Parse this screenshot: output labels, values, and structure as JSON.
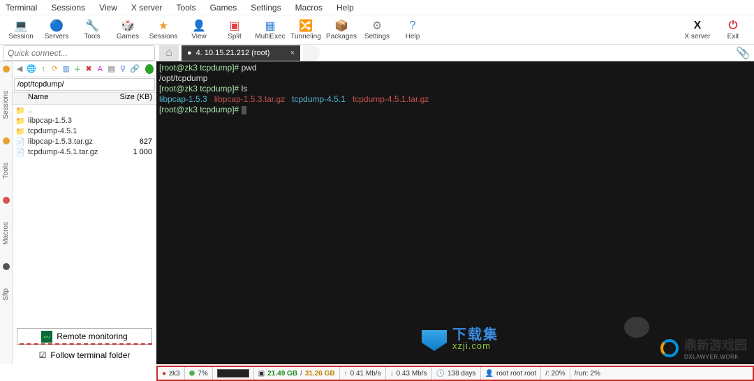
{
  "menu": [
    "Terminal",
    "Sessions",
    "View",
    "X server",
    "Tools",
    "Games",
    "Settings",
    "Macros",
    "Help"
  ],
  "toolbar": [
    {
      "name": "session-btn",
      "label": "Session",
      "icon": "💻",
      "color": "#3a84d8"
    },
    {
      "name": "servers-btn",
      "label": "Servers",
      "icon": "🔵",
      "color": "#e07030"
    },
    {
      "name": "tools-btn",
      "label": "Tools",
      "icon": "🔧",
      "color": "#555"
    },
    {
      "name": "games-btn",
      "label": "Games",
      "icon": "🎲",
      "color": "#d44"
    },
    {
      "name": "sessions-btn",
      "label": "Sessions",
      "icon": "★",
      "color": "#e8a030"
    },
    {
      "name": "view-btn",
      "label": "View",
      "icon": "👤",
      "color": "#33a852"
    },
    {
      "name": "split-btn",
      "label": "Split",
      "icon": "▣",
      "color": "#d44"
    },
    {
      "name": "multiexec-btn",
      "label": "MultiExec",
      "icon": "▦",
      "color": "#3a84d8"
    },
    {
      "name": "tunneling-btn",
      "label": "Tunneling",
      "icon": "🔀",
      "color": "#e8a030"
    },
    {
      "name": "packages-btn",
      "label": "Packages",
      "icon": "📦",
      "color": "#c85020"
    },
    {
      "name": "settings-btn",
      "label": "Settings",
      "icon": "⚙",
      "color": "#888"
    },
    {
      "name": "help-btn",
      "label": "Help",
      "icon": "?",
      "color": "#3a84d8"
    }
  ],
  "toolbar_right": [
    {
      "name": "xserver-btn",
      "label": "X server",
      "icon": "X",
      "color": "#222"
    },
    {
      "name": "exit-btn",
      "label": "Exit",
      "icon": "⏻",
      "color": "#d33"
    }
  ],
  "quick_connect_placeholder": "Quick connect...",
  "tabs": {
    "active": "4. 10.15.21.212 (root)"
  },
  "vtabs": [
    "Sessions",
    "Tools",
    "Macros",
    "Sftp"
  ],
  "sftp": {
    "path": "/opt/tcpdump/",
    "status_color": "#29a329",
    "columns": {
      "name": "Name",
      "size": "Size (KB)"
    },
    "files": [
      {
        "icon": "📁",
        "color": "#5db85d",
        "name": "..",
        "size": ""
      },
      {
        "icon": "📁",
        "color": "#e8b030",
        "name": "libpcap-1.5.3",
        "size": ""
      },
      {
        "icon": "📁",
        "color": "#e8b030",
        "name": "tcpdump-4.5.1",
        "size": ""
      },
      {
        "icon": "📄",
        "color": "#888",
        "name": "libpcap-1.5.3.tar.gz",
        "size": "627"
      },
      {
        "icon": "📄",
        "color": "#888",
        "name": "tcpdump-4.5.1.tar.gz",
        "size": "1 000"
      }
    ],
    "remote_monitoring": "Remote monitoring",
    "follow": "Follow terminal folder"
  },
  "terminal": {
    "lines": [
      {
        "prompt": "[root@zk3 tcpdump]# ",
        "cmd": "pwd"
      },
      {
        "out": "/opt/tcpdump"
      },
      {
        "prompt": "[root@zk3 tcpdump]# ",
        "cmd": "ls"
      },
      {
        "ls": [
          "libpcap-1.5.3",
          "libpcap-1.5.3.tar.gz",
          "tcpdump-4.5.1",
          "tcpdump-4.5.1.tar.gz"
        ]
      },
      {
        "prompt": "[root@zk3 tcpdump]# ",
        "cursor": true
      }
    ]
  },
  "status": {
    "host": "zk3",
    "cpu": "7%",
    "disk_used": "21.49 GB",
    "disk_total": "31.26 GB",
    "up": "0.41 Mb/s",
    "down": "0.43 Mb/s",
    "uptime": "138 days",
    "user": "root root root",
    "rootfs": "/: 20%",
    "run": "/run: 2%"
  },
  "watermark1": {
    "t1": "下载集",
    "t2": "xzji.com"
  },
  "watermark2": {
    "t1": "鼎新游戏园",
    "t2": "DXLAWYER.WORK"
  }
}
